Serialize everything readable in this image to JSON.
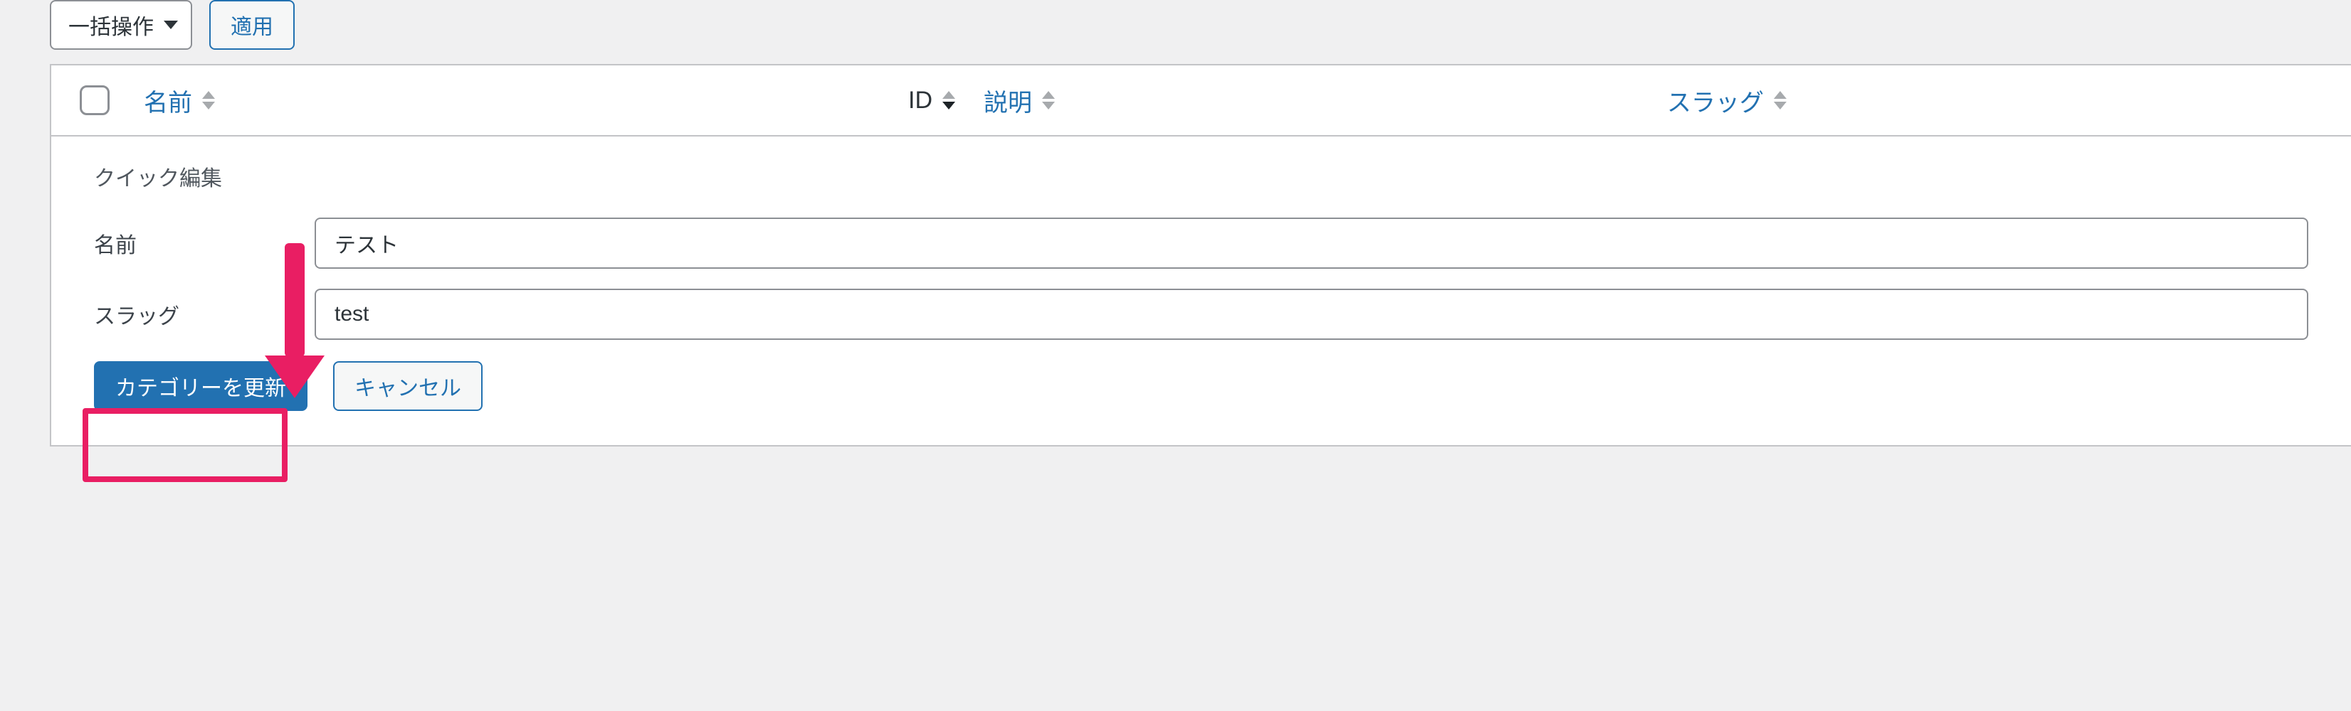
{
  "bulk": {
    "select_label": "一括操作",
    "apply_label": "適用"
  },
  "columns": {
    "name": "名前",
    "id": "ID",
    "description": "説明",
    "slug": "スラッグ"
  },
  "quick_edit": {
    "title": "クイック編集",
    "name_label": "名前",
    "name_value": "テスト",
    "slug_label": "スラッグ",
    "slug_value": "test",
    "update_label": "カテゴリーを更新",
    "cancel_label": "キャンセル"
  }
}
